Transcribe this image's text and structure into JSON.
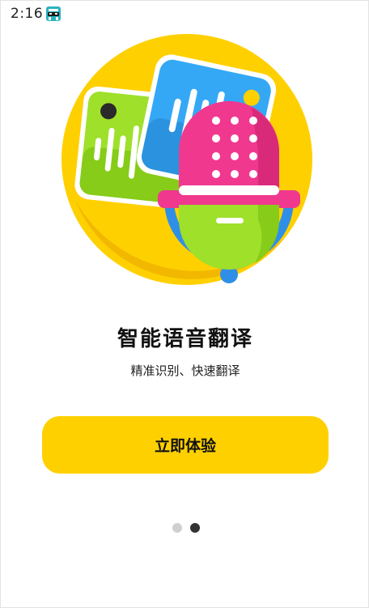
{
  "status_bar": {
    "time": "2:16",
    "app_icon": "robot-notification-icon"
  },
  "hero": {
    "illustration": "voice-translation-illustration",
    "colors": {
      "circle": "#ffd000",
      "green_bubble": "#9ee02a",
      "blue_bubble": "#35a8f5",
      "mic_head": "#f0388f",
      "mic_body": "#9ee02a",
      "mic_stand": "#2f8fe6"
    }
  },
  "onboarding": {
    "title": "智能语音翻译",
    "subtitle": "精准识别、快速翻译",
    "cta_label": "立即体验"
  },
  "pager": {
    "page_count": 2,
    "active_page": 2
  },
  "colors": {
    "accent": "#ffd000",
    "dot_inactive": "#cfcfcf",
    "dot_active": "#333333"
  }
}
